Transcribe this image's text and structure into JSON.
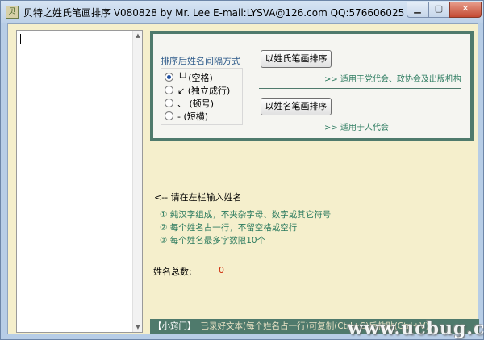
{
  "window": {
    "title": "贝特之姓氏笔画排序  V080828  by Mr. Lee  E-mail:LYSVA@126.com  QQ:576606025",
    "icon": "app-icon",
    "controls": {
      "minimize_icon": "minimize-icon",
      "maximize_icon": "maximize-icon",
      "close_icon": "close-icon"
    }
  },
  "options": {
    "separator_label": "排序后姓名间隔方式",
    "radios": [
      {
        "label": "└┘(空格)",
        "checked": true
      },
      {
        "label": "↙ (独立成行)",
        "checked": false
      },
      {
        "label": "、 (顿号)",
        "checked": false
      },
      {
        "label": "- (短横)",
        "checked": false
      }
    ],
    "sort_by_surname_button": "以姓氏笔画排序",
    "sort_by_surname_hint": ">> 适用于党代会、政协会及出版机构",
    "sort_by_name_button": "以姓名笔画排序",
    "sort_by_name_hint": ">> 适用于人代会"
  },
  "instructions": {
    "title": "<-- 请在左栏输入姓名",
    "items": [
      "① 纯汉字组成，不夹杂字母、数字或其它符号",
      "② 每个姓名占一行，不留空格或空行",
      "③ 每个姓名最多字数限10个"
    ]
  },
  "count": {
    "label": "姓名总数:",
    "value": "0"
  },
  "footer": {
    "tip_label": "【小窍门】",
    "tip_text": "已录好文本(每个姓名占一行)可复制(Ctrl+C)后粘贴(Ctrl+V)"
  },
  "watermark": "www.ucbug.cc",
  "colors": {
    "panel_border": "#4f7a6c",
    "background": "#f5efcc",
    "hint": "#2a7a5e",
    "count": "#cc2200"
  }
}
